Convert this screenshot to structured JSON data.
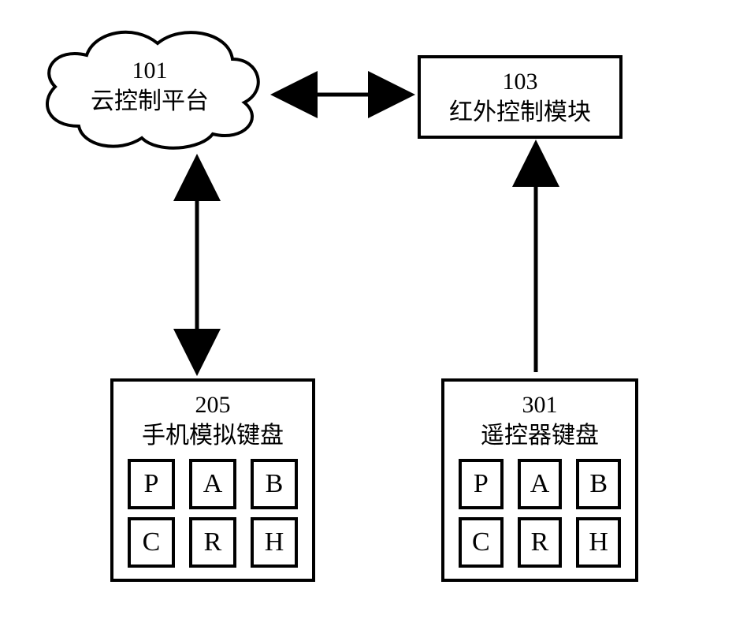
{
  "cloud": {
    "id": "101",
    "label": "云控制平台"
  },
  "module": {
    "id": "103",
    "label": "红外控制模块"
  },
  "phone_keypad": {
    "id": "205",
    "label": "手机模拟键盘",
    "keys": [
      "P",
      "A",
      "B",
      "C",
      "R",
      "H"
    ]
  },
  "remote_keypad": {
    "id": "301",
    "label": "遥控器键盘",
    "keys": [
      "P",
      "A",
      "B",
      "C",
      "R",
      "H"
    ]
  },
  "connections": [
    {
      "from": "101-cloud",
      "to": "103-module",
      "bidirectional": true
    },
    {
      "from": "101-cloud",
      "to": "205-phone-keypad",
      "bidirectional": true
    },
    {
      "from": "301-remote-keypad",
      "to": "103-module",
      "bidirectional": false
    }
  ]
}
